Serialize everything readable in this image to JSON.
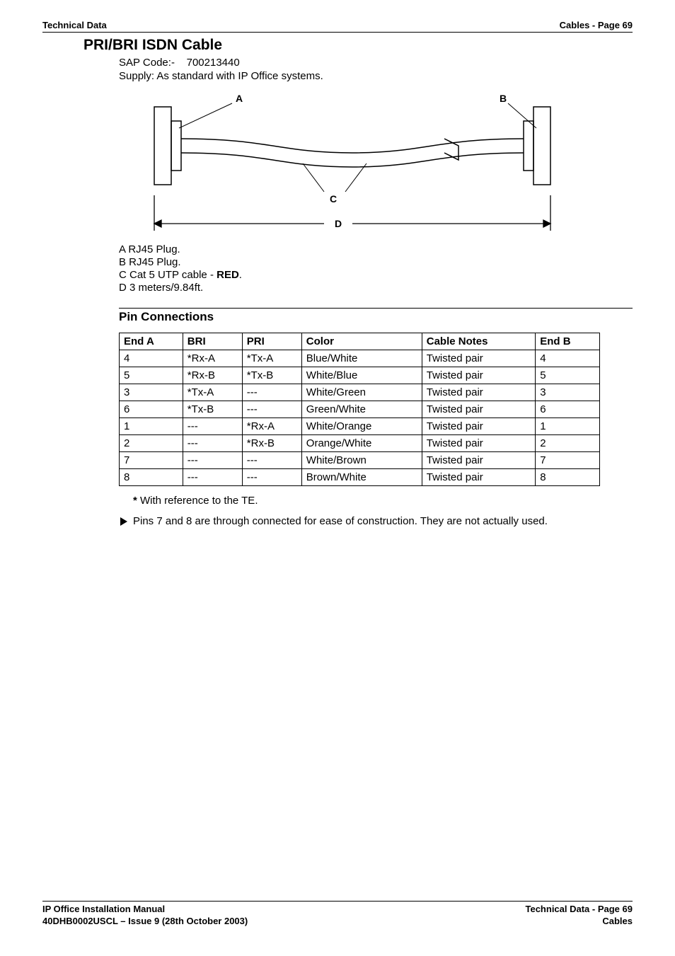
{
  "header": {
    "left": "Technical Data",
    "right": "Cables - Page 69"
  },
  "title": "PRI/BRI ISDN Cable",
  "meta": {
    "sap_label": "SAP Code:-",
    "sap_value": "700213440",
    "supply": "Supply:  As standard with IP Office systems."
  },
  "diagram_labels": {
    "A": "A",
    "B": "B",
    "C": "C",
    "D": "D"
  },
  "legend": {
    "A": "A  RJ45 Plug.",
    "B": "B  RJ45 Plug.",
    "C_prefix": "C  Cat 5 UTP cable - ",
    "C_red": "RED",
    "C_suffix": ".",
    "D": "D  3 meters/9.84ft."
  },
  "pin_section": {
    "heading": "Pin Connections",
    "headers": [
      "End A",
      "BRI",
      "PRI",
      "Color",
      "Cable Notes",
      "End B"
    ],
    "rows": [
      [
        "4",
        "*Rx-A",
        "*Tx-A",
        "Blue/White",
        "Twisted pair",
        "4"
      ],
      [
        "5",
        "*Rx-B",
        "*Tx-B",
        "White/Blue",
        "Twisted pair",
        "5"
      ],
      [
        "3",
        "*Tx-A",
        "---",
        "White/Green",
        "Twisted pair",
        "3"
      ],
      [
        "6",
        "*Tx-B",
        "---",
        "Green/White",
        "Twisted pair",
        "6"
      ],
      [
        "1",
        "---",
        "*Rx-A",
        "White/Orange",
        "Twisted pair",
        "1"
      ],
      [
        "2",
        "---",
        "*Rx-B",
        "Orange/White",
        "Twisted pair",
        "2"
      ],
      [
        "7",
        "---",
        "---",
        "White/Brown",
        "Twisted pair",
        "7"
      ],
      [
        "8",
        "---",
        "---",
        "Brown/White",
        "Twisted pair",
        "8"
      ]
    ]
  },
  "footnote_star": "* With reference to the TE.",
  "note_arrow": "Pins 7 and 8 are through connected for ease of construction. They are not actually used.",
  "footer": {
    "left_line1": "IP Office Installation Manual",
    "left_line2": "40DHB0002USCL – Issue 9 (28th October 2003)",
    "right_line1": "Technical Data - Page 69",
    "right_line2": "Cables"
  }
}
